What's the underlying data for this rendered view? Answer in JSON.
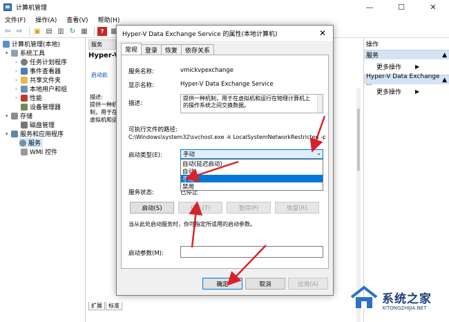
{
  "window": {
    "title": "计算机管理",
    "controls": {
      "minimize": "—",
      "maximize": "☐",
      "close": "✕"
    }
  },
  "menubar": [
    "文件(F)",
    "操作(A)",
    "查看(V)",
    "帮助(H)"
  ],
  "tree": {
    "root": "计算机管理(本地)",
    "system_tools": "系统工具",
    "task_scheduler": "任务计划程序",
    "event_viewer": "事件查看器",
    "shared_folders": "共享文件夹",
    "local_users": "本地用户和组",
    "performance": "性能",
    "device_manager": "设备管理器",
    "storage": "存储",
    "disk_management": "磁盘管理",
    "services_apps": "服务和应用程序",
    "services": "服务",
    "wmi": "WMI 控件"
  },
  "middle": {
    "tab_label": "服务",
    "header": "Hyper-V",
    "start_link": "启动此",
    "description_label": "描述:",
    "description_text": "提供一种机制，用于在虚拟机和运行在物理计算机上的操作系统之间交换数据。",
    "bottom_tabs": [
      "扩展",
      "标准"
    ]
  },
  "actions": {
    "title": "操作",
    "section1": "服务",
    "section1_item": "更多操作",
    "section2": "Hyper-V Data Exchange ...",
    "section2_item": "更多操作"
  },
  "dialog": {
    "title": "Hyper-V Data Exchange Service 的属性(本地计算机)",
    "close": "✕",
    "tabs": [
      "常规",
      "登录",
      "恢复",
      "依存关系"
    ],
    "service_name_label": "服务名称:",
    "service_name": "vmickvpexchange",
    "display_name_label": "显示名称:",
    "display_name": "Hyper-V Data Exchange Service",
    "description_label": "描述:",
    "description": "提供一种机制，用于在虚拟机和运行在物理计算机上的操作系统之间交换数据。",
    "path_label": "可执行文件的路径:",
    "path": "C:\\Windows\\system32\\svchost.exe -k LocalSystemNetworkRestricted -p",
    "startup_type_label": "启动类型(E):",
    "startup_type_value": "手动",
    "startup_options": [
      "自动(延迟启动)",
      "自动",
      "手动",
      "禁用"
    ],
    "startup_highlight_index": 2,
    "status_label": "服务状态:",
    "status_value": "已停止",
    "buttons": {
      "start": "启动(S)",
      "stop": "停止(T)",
      "pause": "暂停(P)",
      "resume": "恢复(R)"
    },
    "hint": "当从此处启动服务时，你可指定所适用的启动参数。",
    "param_label": "启动参数(M):",
    "ok": "确定",
    "cancel": "取消",
    "apply": "应用(A)"
  },
  "watermark": {
    "main": "系统之家",
    "sub": "XITONGZHIJIA.NET"
  },
  "colors": {
    "accent": "#0078d7",
    "arrow": "#d8222a",
    "selection": "#cde8ff",
    "action_header": "#d5e4f2"
  }
}
